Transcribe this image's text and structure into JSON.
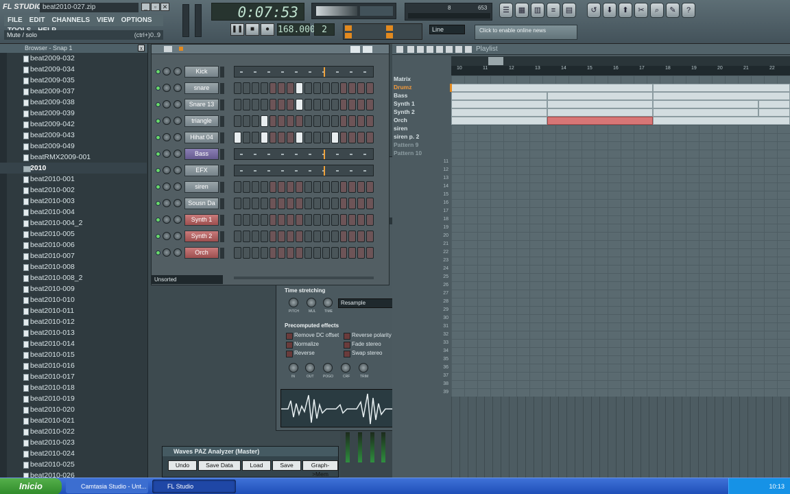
{
  "window": {
    "app_logo": "FL STUDIO",
    "filename": "beat2010-027.zip",
    "menus": [
      "FILE",
      "EDIT",
      "CHANNELS",
      "VIEW",
      "OPTIONS",
      "TOOLS",
      "HELP"
    ],
    "hint_text": "Mute / solo",
    "hint_shortcut": "(ctrl+)0..9"
  },
  "transport": {
    "time": "0:07:53",
    "tempo": "168.000",
    "pattern": "2",
    "snap": "Line",
    "cpu": "653",
    "poly": "8",
    "online_text": "Click to enable online news"
  },
  "browser": {
    "title": "Browser - Snap 1",
    "items": [
      {
        "label": "beat2009-032",
        "folder": false
      },
      {
        "label": "beat2009-034",
        "folder": false
      },
      {
        "label": "beat2009-035",
        "folder": false
      },
      {
        "label": "beat2009-037",
        "folder": false
      },
      {
        "label": "beat2009-038",
        "folder": false
      },
      {
        "label": "beat2009-039",
        "folder": false
      },
      {
        "label": "beat2009-042",
        "folder": false
      },
      {
        "label": "beat2009-043",
        "folder": false
      },
      {
        "label": "beat2009-049",
        "folder": false
      },
      {
        "label": "beatRMX2009-001",
        "folder": false
      },
      {
        "label": "2010",
        "folder": true
      },
      {
        "label": "beat2010-001",
        "folder": false
      },
      {
        "label": "beat2010-002",
        "folder": false
      },
      {
        "label": "beat2010-003",
        "folder": false
      },
      {
        "label": "beat2010-004",
        "folder": false
      },
      {
        "label": "beat2010-004_2",
        "folder": false
      },
      {
        "label": "beat2010-005",
        "folder": false
      },
      {
        "label": "beat2010-006",
        "folder": false
      },
      {
        "label": "beat2010-007",
        "folder": false
      },
      {
        "label": "beat2010-008",
        "folder": false
      },
      {
        "label": "beat2010-008_2",
        "folder": false
      },
      {
        "label": "beat2010-009",
        "folder": false
      },
      {
        "label": "beat2010-010",
        "folder": false
      },
      {
        "label": "beat2010-011",
        "folder": false
      },
      {
        "label": "beat2010-012",
        "folder": false
      },
      {
        "label": "beat2010-013",
        "folder": false
      },
      {
        "label": "beat2010-014",
        "folder": false
      },
      {
        "label": "beat2010-015",
        "folder": false
      },
      {
        "label": "beat2010-016",
        "folder": false
      },
      {
        "label": "beat2010-017",
        "folder": false
      },
      {
        "label": "beat2010-018",
        "folder": false
      },
      {
        "label": "beat2010-019",
        "folder": false
      },
      {
        "label": "beat2010-020",
        "folder": false
      },
      {
        "label": "beat2010-021",
        "folder": false
      },
      {
        "label": "beat2010-022",
        "folder": false
      },
      {
        "label": "beat2010-023",
        "folder": false
      },
      {
        "label": "beat2010-024",
        "folder": false
      },
      {
        "label": "beat2010-025",
        "folder": false
      },
      {
        "label": "beat2010-026",
        "folder": false
      }
    ]
  },
  "channel_rack": {
    "filter": "Unsorted",
    "channels": [
      {
        "name": "Kick",
        "color": "grey",
        "mode": "piano",
        "on_steps": []
      },
      {
        "name": "snare",
        "color": "grey",
        "mode": "steps",
        "on_steps": [
          7
        ]
      },
      {
        "name": "Snare 13",
        "color": "grey",
        "mode": "steps",
        "on_steps": [
          7
        ]
      },
      {
        "name": "triangle",
        "color": "grey",
        "mode": "steps",
        "on_steps": [
          3
        ]
      },
      {
        "name": "Hihat 04",
        "color": "grey",
        "mode": "steps",
        "on_steps": [
          0,
          3,
          7,
          11
        ]
      },
      {
        "name": "Bass",
        "color": "purple",
        "mode": "piano",
        "on_steps": []
      },
      {
        "name": "EFX",
        "color": "grey",
        "mode": "piano",
        "on_steps": []
      },
      {
        "name": "siren",
        "color": "grey",
        "mode": "steps",
        "on_steps": []
      },
      {
        "name": "Sousn Da ...",
        "color": "grey",
        "mode": "steps",
        "on_steps": []
      },
      {
        "name": "Synth 1",
        "color": "red",
        "mode": "steps",
        "on_steps": []
      },
      {
        "name": "Synth 2",
        "color": "red",
        "mode": "steps",
        "on_steps": []
      },
      {
        "name": "Orch",
        "color": "red",
        "mode": "steps",
        "on_steps": []
      }
    ]
  },
  "sampler": {
    "time_stretch_title": "Time stretching",
    "stretch_knobs": [
      "PITCH",
      "MUL",
      "TIME"
    ],
    "resample_label": "Resample",
    "precomputed_title": "Precomputed effects",
    "effects_left": [
      "Remove DC offset",
      "Normalize",
      "Reverse"
    ],
    "effects_right": [
      "Reverse polarity",
      "Fade stereo",
      "Swap stereo"
    ],
    "effect_knobs": [
      "IN",
      "OUT",
      "POGO",
      "CRF",
      "TRIM"
    ]
  },
  "playlist": {
    "title": "Playlist",
    "tracks": [
      "Matrix",
      "Drumz",
      "Bass",
      "Synth 1",
      "Synth 2",
      "Orch",
      "siren",
      "siren p. 2",
      "Pattern 9",
      "Pattern 10"
    ],
    "selected_track": "Drumz",
    "bar_numbers": [
      "10",
      "11",
      "12",
      "13",
      "14",
      "15",
      "16",
      "17",
      "18",
      "19",
      "20",
      "21",
      "22"
    ],
    "row_numbers": [
      "11",
      "12",
      "13",
      "14",
      "15",
      "16",
      "17",
      "18",
      "19",
      "20",
      "21",
      "22",
      "23",
      "24",
      "25",
      "26",
      "27",
      "28",
      "29",
      "30",
      "31",
      "32",
      "33",
      "34",
      "35",
      "36",
      "37",
      "38",
      "39"
    ]
  },
  "paz": {
    "title": "Waves PAZ Analyzer (Master)",
    "buttons": [
      "Undo",
      "Save Data",
      "Load",
      "Save",
      "Graph->Mem"
    ]
  },
  "taskbar": {
    "start_label": "Inicio",
    "tasks": [
      "Camtasia Studio - Unt...",
      "FL Studio"
    ],
    "clock": "10:13"
  }
}
